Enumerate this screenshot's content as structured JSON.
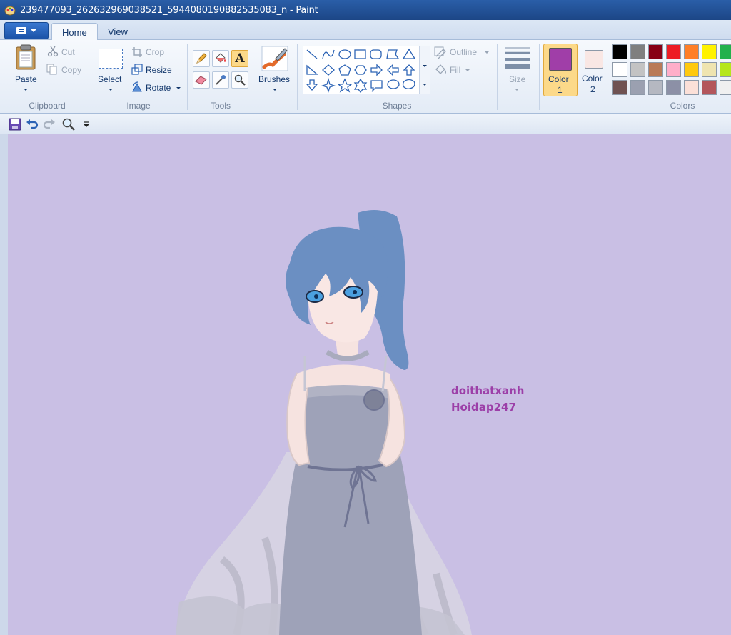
{
  "window": {
    "title": "239477093_262632969038521_5944080190882535083_n - Paint"
  },
  "tabs": [
    {
      "label": "Home",
      "active": true
    },
    {
      "label": "View",
      "active": false
    }
  ],
  "clipboard": {
    "paste_label": "Paste",
    "cut_label": "Cut",
    "copy_label": "Copy",
    "group_label": "Clipboard"
  },
  "image": {
    "select_label": "Select",
    "crop_label": "Crop",
    "resize_label": "Resize",
    "rotate_label": "Rotate",
    "group_label": "Image"
  },
  "tools": {
    "group_label": "Tools",
    "items": [
      "pencil-icon",
      "fill-bucket-icon",
      "text-icon",
      "eraser-icon",
      "color-picker-icon",
      "magnifier-icon"
    ],
    "text_tool_glyph": "A",
    "active_tool": "text-icon"
  },
  "brushes": {
    "label": "Brushes"
  },
  "shapes": {
    "group_label": "Shapes",
    "outline_label": "Outline",
    "fill_label": "Fill"
  },
  "size": {
    "label": "Size"
  },
  "colors": {
    "color1_label": "Color",
    "color1_num": "1",
    "color2_label": "Color",
    "color2_num": "2",
    "group_label": "Colors",
    "color1": "#a03ea8",
    "color2": "#f9e7e4",
    "palette": [
      [
        "#000000",
        "#7f7f7f",
        "#880015",
        "#ed1c24",
        "#ff7f27",
        "#fff200",
        "#22b14c"
      ],
      [
        "#ffffff",
        "#c3c3c3",
        "#b97a57",
        "#ffaec9",
        "#ffc90e",
        "#efe4b0",
        "#b5e61d"
      ],
      [
        "#6f5252",
        "#9ba0b0",
        "#b5b8c1",
        "#8c90a6",
        "#fbe0d8",
        "#b3565c",
        "#f0f0f0"
      ]
    ]
  },
  "quick_access": {
    "items": [
      "save-icon",
      "undo-icon",
      "redo-icon",
      "zoom-icon",
      "customize-icon"
    ]
  },
  "canvas": {
    "background": "#c9bfe4",
    "text_line1": "doithatxanh",
    "text_line2": "Hoidap247"
  }
}
